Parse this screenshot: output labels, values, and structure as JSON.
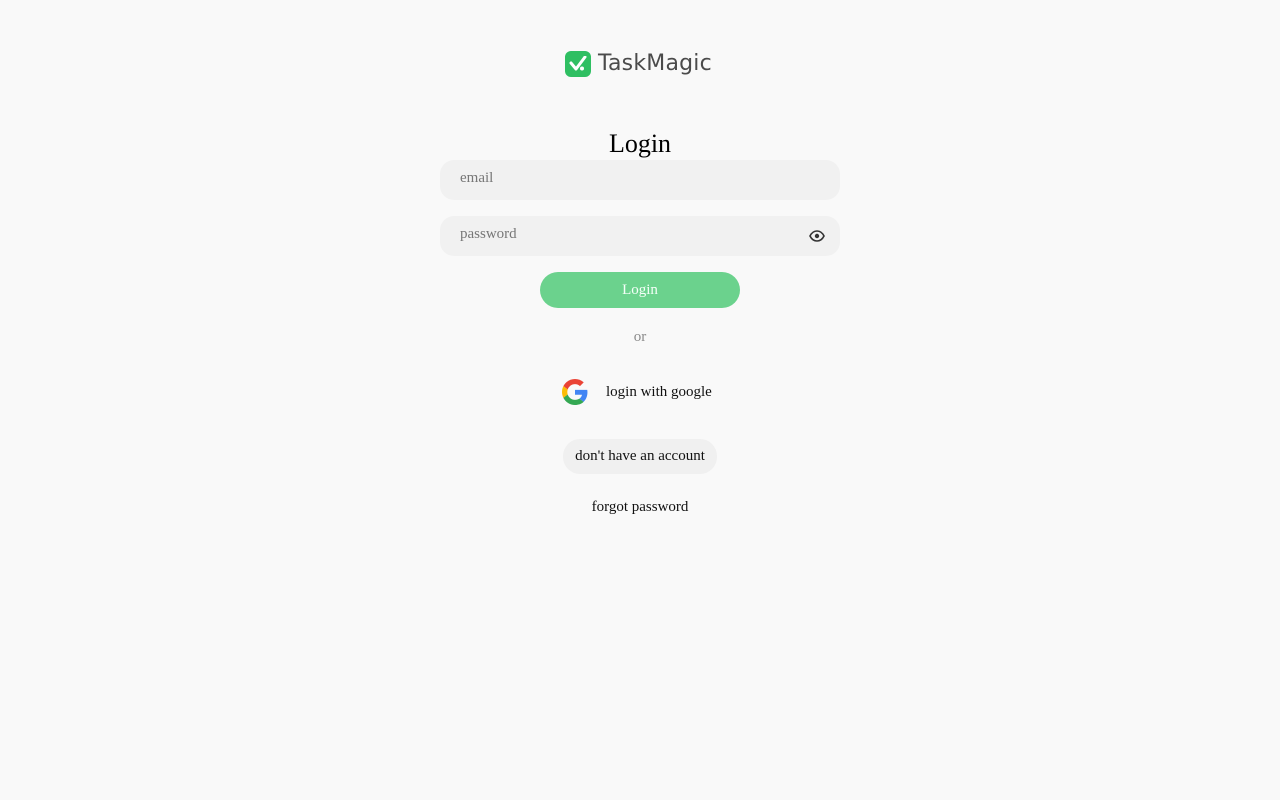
{
  "brand": {
    "name": "TaskMagic",
    "logo_icon": "check-badge-icon",
    "accent_color": "#2fbf62"
  },
  "form": {
    "title": "Login",
    "email_placeholder": "email",
    "email_value": "",
    "password_placeholder": "password",
    "password_value": "",
    "password_toggle_icon": "eye-icon",
    "submit_label": "Login",
    "submit_color": "#6bd28d"
  },
  "alt_login": {
    "divider_text": "or",
    "google_label": "login with google",
    "google_icon": "google-icon"
  },
  "links": {
    "signup_label": "don't have an account",
    "forgot_label": "forgot password"
  }
}
